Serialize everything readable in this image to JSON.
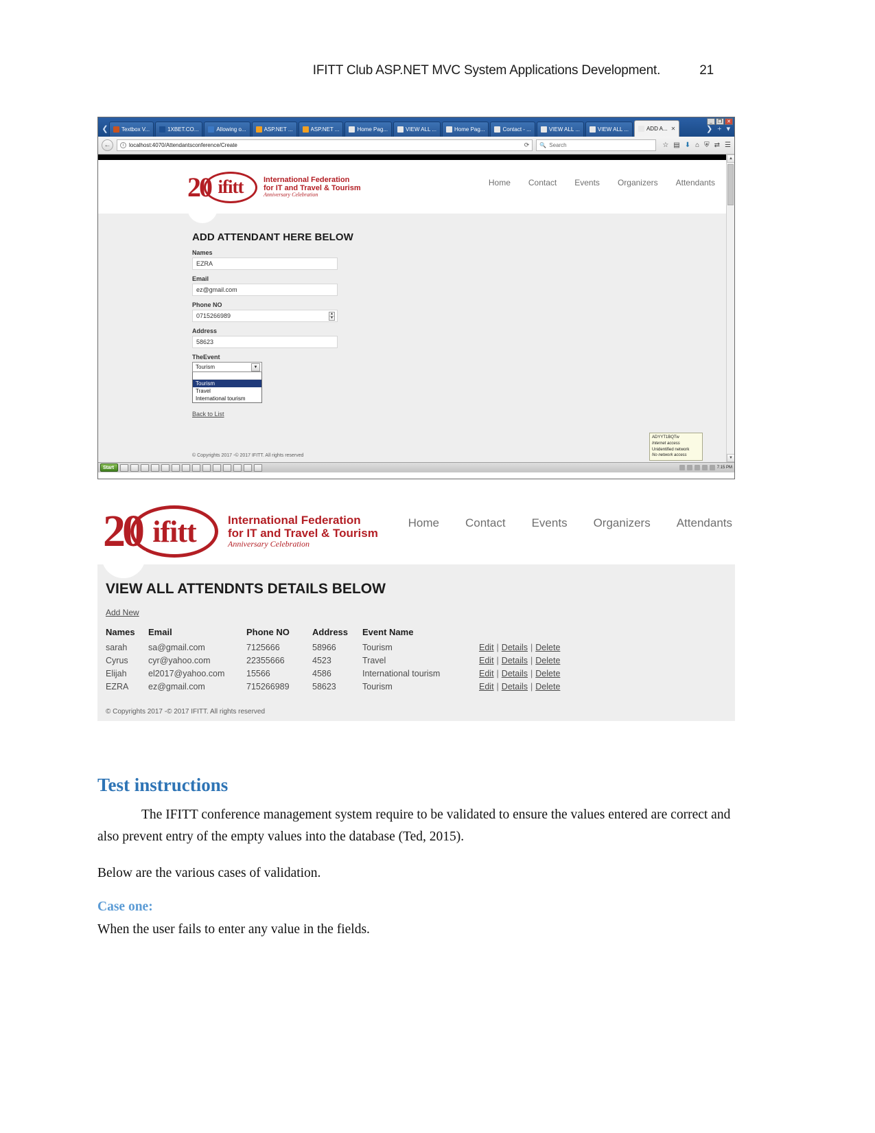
{
  "page_header": {
    "title": "IFITT  Club ASP.NET MVC System Applications Development.",
    "page_number": "21"
  },
  "browser": {
    "tabs": [
      {
        "label": "Textbox V...",
        "favicon": "#c8531f"
      },
      {
        "label": "1XBET.CO...",
        "favicon": "#1d4f91"
      },
      {
        "label": "Allowing o...",
        "favicon": "#3b78c4"
      },
      {
        "label": "ASP.NET ...",
        "favicon": "#f2a022"
      },
      {
        "label": "ASP.NET ...",
        "favicon": "#f2a022"
      },
      {
        "label": "Home Pag...",
        "favicon": "#e8e8e8"
      },
      {
        "label": "VIEW ALL ...",
        "favicon": "#e8e8e8"
      },
      {
        "label": "Home Pag...",
        "favicon": "#e8e8e8"
      },
      {
        "label": "Contact - ...",
        "favicon": "#e8e8e8"
      },
      {
        "label": "VIEW ALL ...",
        "favicon": "#e8e8e8"
      },
      {
        "label": "VIEW ALL ...",
        "favicon": "#e8e8e8"
      },
      {
        "label": "ADD A...",
        "favicon": "#e8e8e8",
        "active": true
      }
    ],
    "tab_close_glyph": "✕",
    "tab_list_glyph": "❯",
    "new_tab_glyph": "+",
    "menu_caret_glyph": "▾",
    "window_buttons": {
      "minimize": "_",
      "maximize": "❐",
      "close": "✕"
    },
    "nav": {
      "back_glyph": "←",
      "info_glyph": "i",
      "url": "localhost:4070/Attendantsconference/Create",
      "reload_glyph": "⟳",
      "search_icon": "search-icon",
      "search_placeholder": "Search",
      "icons": [
        "star-icon",
        "reading-list-icon",
        "downloads-icon",
        "home-icon",
        "shield-icon",
        "sync-icon",
        "hamburger-menu-icon"
      ]
    }
  },
  "site": {
    "logo": {
      "anniversary": "20",
      "brand": "ifitt",
      "line1": "International Federation",
      "line2": "for IT and Travel & Tourism",
      "line3": "Anniversary Celebration"
    },
    "nav_items": [
      "Home",
      "Contact",
      "Events",
      "Organizers",
      "Attendants"
    ],
    "copyright": "© Copyrights 2017 -© 2017 IFITT. All rights reserved"
  },
  "create_form": {
    "heading": "ADD ATTENDANT HERE BELOW",
    "fields": [
      {
        "label": "Names",
        "value": "EZRA"
      },
      {
        "label": "Email",
        "value": "ez@gmail.com"
      },
      {
        "label": "Phone NO",
        "value": "0715266989"
      },
      {
        "label": "Address",
        "value": "58623"
      }
    ],
    "select": {
      "label": "TheEvent",
      "value": "Tourism",
      "arrow_glyph": "▼",
      "options": [
        "",
        "Tourism",
        "Travel",
        "International tourism"
      ],
      "selected_index": 1
    },
    "back_link": "Back to List"
  },
  "network_popup": {
    "ssid": "ADYYT1BQTw",
    "ssid_status": "Internet access",
    "network": "Unidentified network",
    "network_status": "No network access"
  },
  "taskbar": {
    "start_label": "Start",
    "clock": "7:15 PM"
  },
  "list_page": {
    "heading": "VIEW ALL ATTENDNTS DETAILS BELOW",
    "add_new": "Add New",
    "columns": [
      "Names",
      "Email",
      "Phone NO",
      "Address",
      "Event Name"
    ],
    "actions": {
      "edit": "Edit",
      "details": "Details",
      "delete": "Delete",
      "separator": "|"
    },
    "rows": [
      {
        "name": "sarah",
        "email": "sa@gmail.com",
        "phone": "7125666",
        "address": "58966",
        "event": "Tourism"
      },
      {
        "name": "Cyrus",
        "email": "cyr@yahoo.com",
        "phone": "22355666",
        "address": "4523",
        "event": "Travel"
      },
      {
        "name": "Elijah",
        "email": "el2017@yahoo.com",
        "phone": "15566",
        "address": "4586",
        "event": "International tourism"
      },
      {
        "name": "EZRA",
        "email": "ez@gmail.com",
        "phone": "715266989",
        "address": "58623",
        "event": "Tourism"
      }
    ],
    "copyright": "© Copyrights 2017 -© 2017 IFITT. All rights reserved"
  },
  "document": {
    "section_heading": "Test instructions",
    "paragraph1": "The IFITT conference management system require to be  validated to ensure the values entered are correct  and also prevent entry of the empty values into the database (Ted, 2015).",
    "paragraph2": "Below are the various cases of validation.",
    "case_heading": "Case one:",
    "case_text": "When the user fails to enter any value in the fields."
  }
}
